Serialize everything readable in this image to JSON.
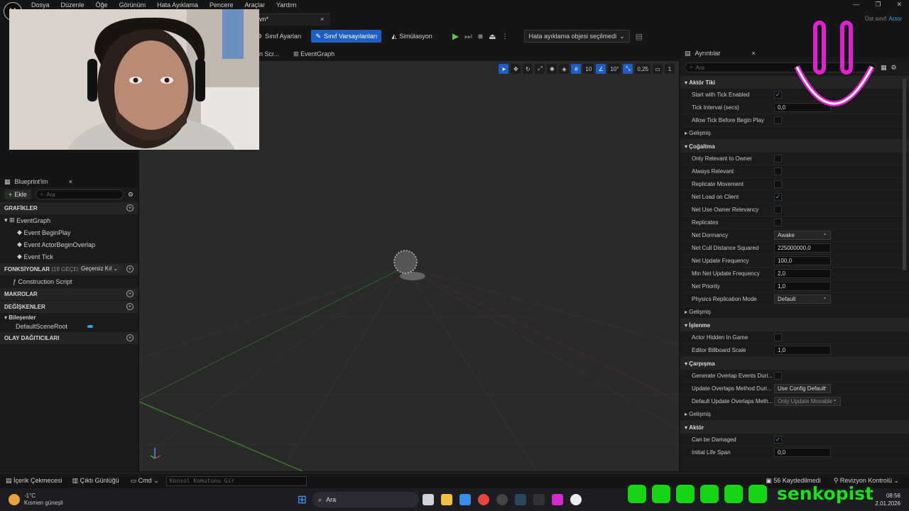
{
  "menu": {
    "items": [
      "Dosya",
      "Düzenle",
      "Öğe",
      "Görünüm",
      "Hata Ayıklama",
      "Pencere",
      "Araçlar",
      "Yardım"
    ]
  },
  "tab": {
    "title": "vn*",
    "close": "×"
  },
  "parent_class": {
    "label": "Üst sınıf:",
    "value": "Actor"
  },
  "toolbar": {
    "class_settings": "Sınıf Ayarları",
    "class_defaults": "Sınıf Varsayılanları",
    "simulation": "Simülasyon",
    "debug_select": "Hata ayıklama objesi seçilmedi"
  },
  "subtabs": {
    "construction": "on Scr...",
    "eventgraph": "EventGraph"
  },
  "viewport_tools": {
    "grid": "10",
    "angle": "10°",
    "scale": "0,25",
    "camera": "1"
  },
  "blueprint_panel": {
    "title": "Blueprint'im",
    "add": "Ekle",
    "search_placeholder": "Ara",
    "graphs_header": "GRAFİKLER",
    "eventgraph": "EventGraph",
    "events": [
      "Event BeginPlay",
      "Event ActorBeginOverlap",
      "Event Tick"
    ],
    "functions_header": "FONKSİYONLAR",
    "functions_count": "(19 GEÇERSİ",
    "override_dropdown": "Geçersiz Kıl",
    "construction_script": "Construction Script",
    "macros_header": "MAKROLAR",
    "variables_header": "DEĞİŞKENLER",
    "components_header": "Bileşenler",
    "default_scene_root": "DefaultSceneRoot",
    "dispatchers_header": "OLAY DAĞITICILARI"
  },
  "details": {
    "title": "Ayrıntılar",
    "search_placeholder": "Ara",
    "sections": [
      {
        "header": "Aktör Tiki",
        "rows": [
          {
            "label": "Start with Tick Enabled",
            "type": "check",
            "checked": true
          },
          {
            "label": "Tick Interval (secs)",
            "type": "value",
            "value": "0,0"
          },
          {
            "label": "Allow Tick Before Begin Play",
            "type": "check",
            "checked": false
          }
        ],
        "advanced": "Gelişmiş"
      },
      {
        "header": "Çoğaltma",
        "rows": [
          {
            "label": "Only Relevant to Owner",
            "type": "check",
            "checked": false
          },
          {
            "label": "Always Relevant",
            "type": "check",
            "checked": false
          },
          {
            "label": "Replicate Movement",
            "type": "check",
            "checked": false
          },
          {
            "label": "Net Load on Client",
            "type": "check",
            "checked": true
          },
          {
            "label": "Net Use Owner Relevancy",
            "type": "check",
            "checked": false
          },
          {
            "label": "Replicates",
            "type": "check",
            "checked": false
          },
          {
            "label": "Net Dormancy",
            "type": "drop",
            "value": "Awake"
          },
          {
            "label": "Net Cull Distance Squared",
            "type": "value",
            "value": "225000000,0"
          },
          {
            "label": "Net Update Frequency",
            "type": "value",
            "value": "100,0"
          },
          {
            "label": "Min Net Update Frequency",
            "type": "value",
            "value": "2,0"
          },
          {
            "label": "Net Priority",
            "type": "value",
            "value": "1,0"
          },
          {
            "label": "Physics Replication Mode",
            "type": "drop",
            "value": "Default"
          }
        ],
        "advanced": "Gelişmiş"
      },
      {
        "header": "İşlenme",
        "rows": [
          {
            "label": "Actor Hidden In Game",
            "type": "check",
            "checked": false
          },
          {
            "label": "Editor Billboard Scale",
            "type": "value",
            "value": "1,0"
          }
        ]
      },
      {
        "header": "Çarpışma",
        "rows": [
          {
            "label": "Generate Overlap Events Duri...",
            "type": "check",
            "checked": false
          },
          {
            "label": "Update Overlaps Method Duri...",
            "type": "drop",
            "value": "Use Config Default"
          },
          {
            "label": "Default Update Overlaps Meth...",
            "type": "dropdis",
            "value": "Only Update Movable"
          }
        ],
        "advanced": "Gelişmiş"
      },
      {
        "header": "Aktör",
        "rows": [
          {
            "label": "Can be Damaged",
            "type": "check",
            "checked": true
          },
          {
            "label": "Initial Life Span",
            "type": "value",
            "value": "0,0"
          }
        ]
      }
    ]
  },
  "statusbar": {
    "content_drawer": "İçerik Çekmecesi",
    "output_log": "Çıktı Günlüğü",
    "cmd": "Cmd",
    "console_placeholder": "Konsol Komutunu Gir",
    "saved": "56 Kaydedilmedi",
    "revision": "Revizyon Kontrolü"
  },
  "taskbar": {
    "temp": "-1°C",
    "weather": "Kısmen güneşli",
    "search": "Ara",
    "time": "08:56",
    "date": "2.01.2026"
  },
  "overlay": {
    "brand": "senkopist"
  },
  "colors": {
    "accent": "#1f5fc4",
    "play": "#5bc24c",
    "brand_green": "#19e019",
    "logo_pink": "#e01fcf"
  }
}
